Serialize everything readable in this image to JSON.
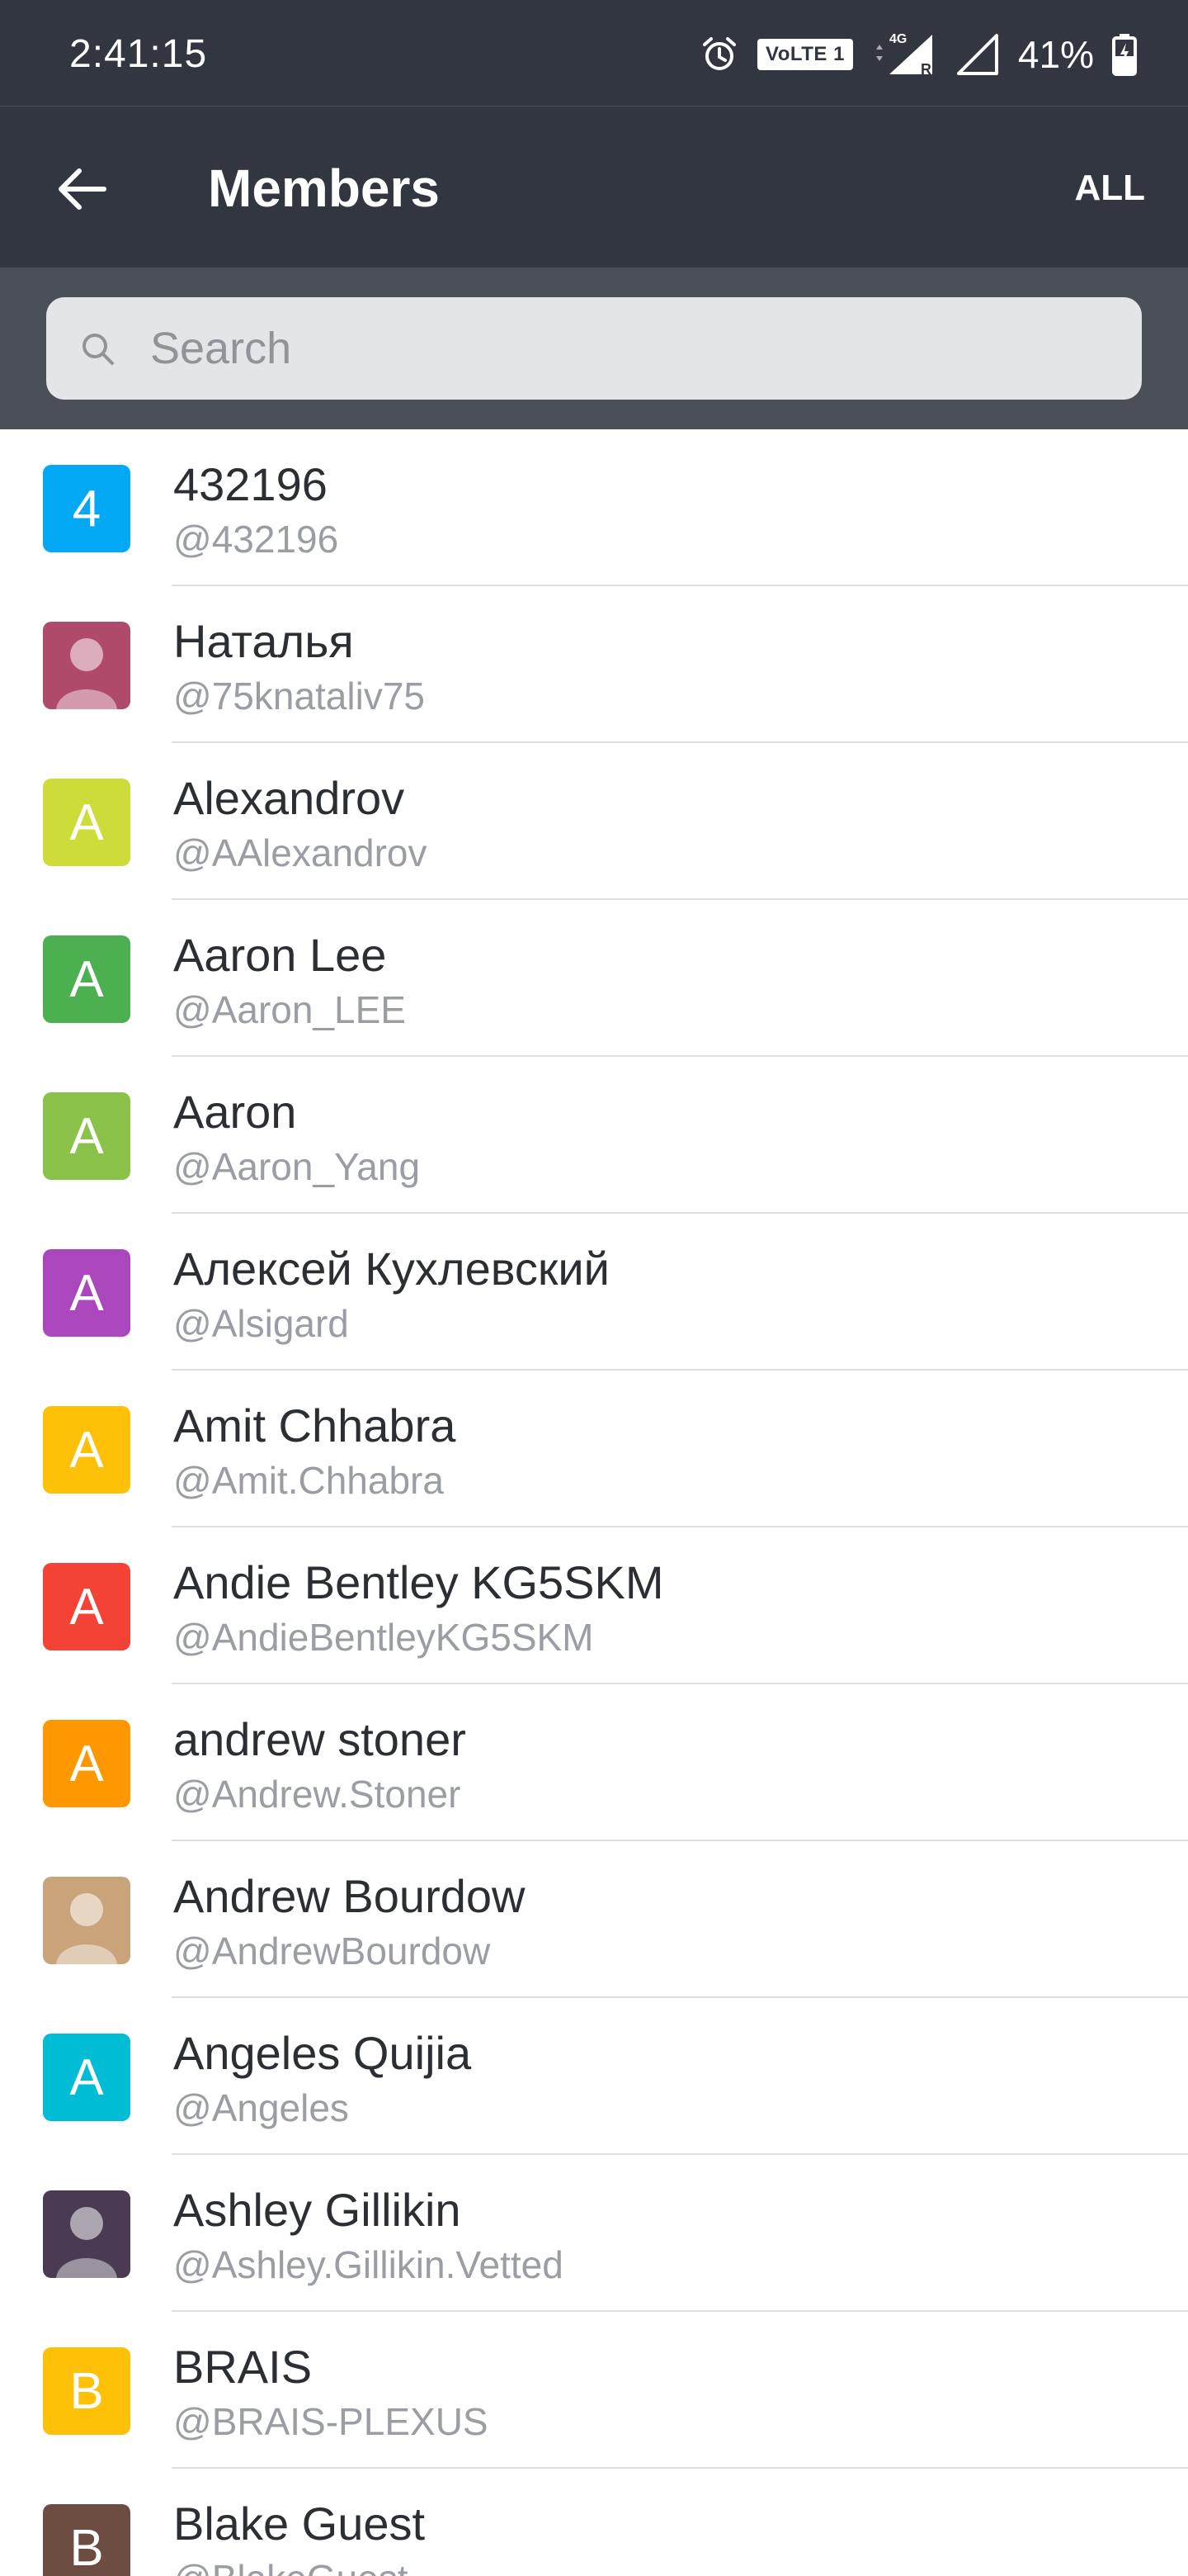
{
  "status_bar": {
    "time": "2:41:15",
    "network_badge": "VoLTE 1",
    "network_type": "4G",
    "roaming": "R",
    "battery": "41%"
  },
  "app_bar": {
    "title": "Members",
    "filter_label": "ALL"
  },
  "search": {
    "placeholder": "Search",
    "value": ""
  },
  "members": [
    {
      "name": "432196",
      "handle": "@432196",
      "avatar_letter": "4",
      "avatar_color": "#03a9f4",
      "avatar_photo": false
    },
    {
      "name": "Наталья",
      "handle": "@75knataliv75",
      "avatar_letter": "",
      "avatar_color": "#b04a6a",
      "avatar_photo": true
    },
    {
      "name": "Alexandrov",
      "handle": "@AAlexandrov",
      "avatar_letter": "A",
      "avatar_color": "#cddc39",
      "avatar_photo": false
    },
    {
      "name": "Aaron Lee",
      "handle": "@Aaron_LEE",
      "avatar_letter": "A",
      "avatar_color": "#4caf50",
      "avatar_photo": false
    },
    {
      "name": "Aaron",
      "handle": "@Aaron_Yang",
      "avatar_letter": "A",
      "avatar_color": "#8bc34a",
      "avatar_photo": false
    },
    {
      "name": "Алексей Кухлевский",
      "handle": "@Alsigard",
      "avatar_letter": "A",
      "avatar_color": "#ab47bc",
      "avatar_photo": false
    },
    {
      "name": "Amit Chhabra",
      "handle": "@Amit.Chhabra",
      "avatar_letter": "A",
      "avatar_color": "#ffc107",
      "avatar_photo": false
    },
    {
      "name": "Andie Bentley KG5SKM",
      "handle": "@AndieBentleyKG5SKM",
      "avatar_letter": "A",
      "avatar_color": "#f44336",
      "avatar_photo": false
    },
    {
      "name": "andrew stoner",
      "handle": "@Andrew.Stoner",
      "avatar_letter": "A",
      "avatar_color": "#ff9800",
      "avatar_photo": false
    },
    {
      "name": "Andrew Bourdow",
      "handle": "@AndrewBourdow",
      "avatar_letter": "",
      "avatar_color": "#c9a47a",
      "avatar_photo": true
    },
    {
      "name": "Angeles Quijia",
      "handle": "@Angeles",
      "avatar_letter": "A",
      "avatar_color": "#00bcd4",
      "avatar_photo": false
    },
    {
      "name": "Ashley Gillikin",
      "handle": "@Ashley.Gillikin.Vetted",
      "avatar_letter": "",
      "avatar_color": "#4a3a52",
      "avatar_photo": true
    },
    {
      "name": "BRAIS",
      "handle": "@BRAIS-PLEXUS",
      "avatar_letter": "B",
      "avatar_color": "#ffc107",
      "avatar_photo": false
    },
    {
      "name": "Blake Guest",
      "handle": "@BlakeGuest",
      "avatar_letter": "B",
      "avatar_color": "#6d4c41",
      "avatar_photo": false
    }
  ]
}
